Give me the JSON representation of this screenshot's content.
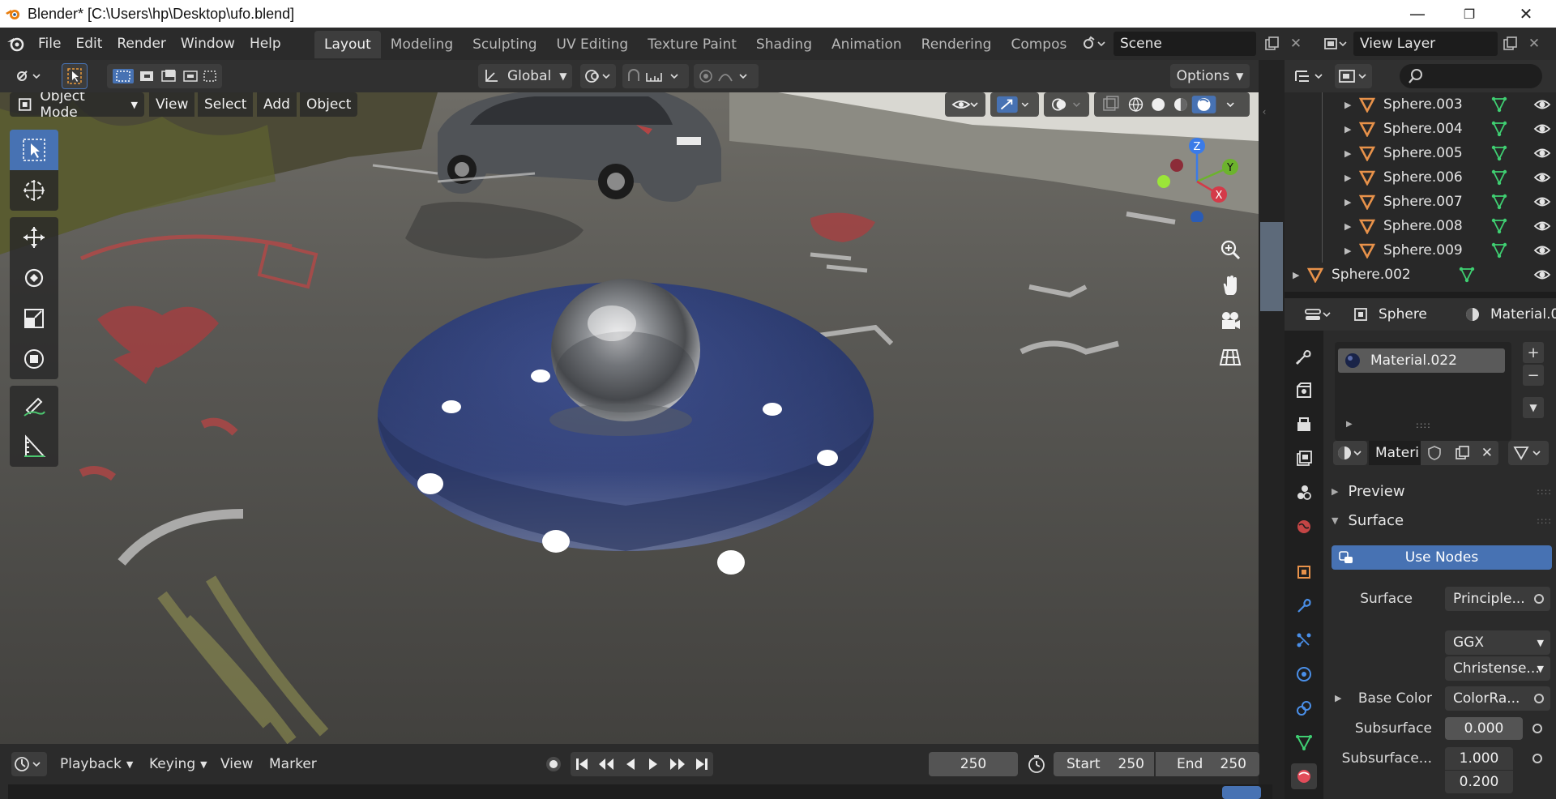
{
  "window": {
    "title": "Blender* [C:\\Users\\hp\\Desktop\\ufo.blend]",
    "controls": {
      "minimize": "—",
      "restore": "❐",
      "close": "✕"
    }
  },
  "menu": {
    "items": [
      "File",
      "Edit",
      "Render",
      "Window",
      "Help"
    ]
  },
  "workspaces": {
    "tabs": [
      "Layout",
      "Modeling",
      "Sculpting",
      "UV Editing",
      "Texture Paint",
      "Shading",
      "Animation",
      "Rendering",
      "Compos"
    ],
    "active": "Layout"
  },
  "scene": {
    "label": "Scene"
  },
  "view_layer": {
    "label": "View Layer"
  },
  "viewport": {
    "mode": "Object Mode",
    "menu": [
      "View",
      "Select",
      "Add",
      "Object"
    ],
    "transform_orientation": "Global",
    "options_label": "Options",
    "gizmo_axes": {
      "z": "Z",
      "y": "Y",
      "x": "X"
    }
  },
  "timeline": {
    "playback": "Playback",
    "keying": "Keying",
    "view": "View",
    "marker": "Marker",
    "current_frame": "250",
    "start_label": "Start",
    "start_value": "250",
    "end_label": "End",
    "end_value": "250"
  },
  "outliner": {
    "rows": [
      {
        "name": "Sphere.003",
        "indent": 2
      },
      {
        "name": "Sphere.004",
        "indent": 2
      },
      {
        "name": "Sphere.005",
        "indent": 2
      },
      {
        "name": "Sphere.006",
        "indent": 2
      },
      {
        "name": "Sphere.007",
        "indent": 2
      },
      {
        "name": "Sphere.008",
        "indent": 2
      },
      {
        "name": "Sphere.009",
        "indent": 2
      },
      {
        "name": "Sphere.002",
        "indent": 1
      }
    ]
  },
  "properties": {
    "object_name": "Sphere",
    "material_breadcrumb": "Material.0",
    "slot_name": "Material.022",
    "material_field": "Materi",
    "panels": {
      "preview": "Preview",
      "surface": "Surface"
    },
    "use_nodes": "Use Nodes",
    "surface_label": "Surface",
    "surface_value": "Principle...",
    "distribution": "GGX",
    "subsurface_method": "Christense...",
    "base_color_label": "Base Color",
    "base_color_value": "ColorRa...",
    "subsurface_label": "Subsurface",
    "subsurface_value": "0.000",
    "subsurface_radius_label": "Subsurface...",
    "subsurface_radius_1": "1.000",
    "subsurface_radius_2": "0.200"
  },
  "colors": {
    "accent_blue": "#4772b3",
    "ufo_body": "#2f3e72",
    "mesh_orange": "#e8924a",
    "data_green": "#3fcf72"
  }
}
